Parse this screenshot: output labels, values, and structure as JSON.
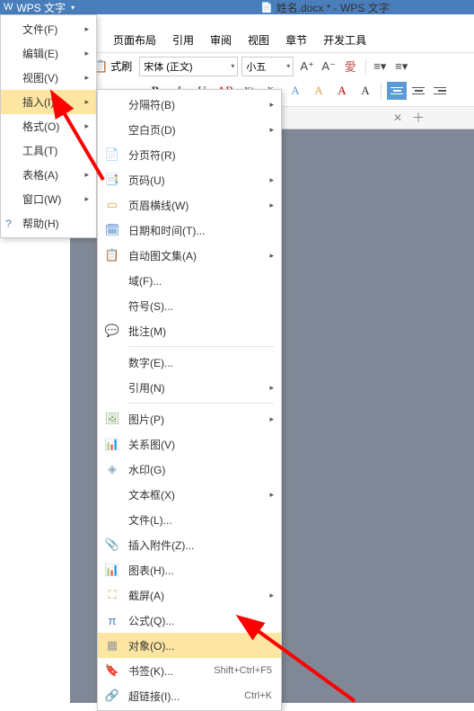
{
  "titlebar": {
    "app_name": "WPS 文字"
  },
  "doc": {
    "title": "姓名.docx * - WPS 文字"
  },
  "menubar": {
    "items": [
      "页面布局",
      "引用",
      "审阅",
      "视图",
      "章节",
      "开发工具"
    ]
  },
  "toolbar": {
    "format_brush": "式刷",
    "font": "宋体 (正文)",
    "size": "小五"
  },
  "format_buttons": {
    "bold": "B",
    "italic": "I",
    "underline": "U",
    "strike": "AB",
    "super": "X²",
    "sub": "X₂",
    "a1": "A",
    "a2": "A",
    "a3": "A",
    "a4": "A"
  },
  "classic_menu": {
    "items": [
      {
        "label": "文件(F)",
        "arrow": true
      },
      {
        "label": "编辑(E)",
        "arrow": true
      },
      {
        "label": "视图(V)",
        "arrow": true
      },
      {
        "label": "插入(I)",
        "arrow": true,
        "highlight": true
      },
      {
        "label": "格式(O)",
        "arrow": true
      },
      {
        "label": "工具(T)",
        "arrow": true
      },
      {
        "label": "表格(A)",
        "arrow": true
      },
      {
        "label": "窗口(W)",
        "arrow": true
      },
      {
        "label": "帮助(H)",
        "arrow": false,
        "icon": "?"
      }
    ]
  },
  "insert_menu": {
    "items": [
      {
        "label": "分隔符(B)",
        "icon": "",
        "arrow": true
      },
      {
        "label": "空白页(D)",
        "icon": "",
        "arrow": true
      },
      {
        "label": "分页符(R)",
        "icon": "📄",
        "color": "#d9a54a"
      },
      {
        "label": "页码(U)",
        "icon": "📑",
        "color": "#d9a54a",
        "arrow": true
      },
      {
        "label": "页眉横线(W)",
        "icon": "▭",
        "color": "#d9a54a",
        "arrow": true
      },
      {
        "label": "日期和时间(T)...",
        "icon": "🗓",
        "color": "#3a7bc8"
      },
      {
        "label": "自动图文集(A)",
        "icon": "📋",
        "color": "#7a9e5e",
        "arrow": true
      },
      {
        "label": "域(F)...",
        "icon": ""
      },
      {
        "label": "符号(S)...",
        "icon": ""
      },
      {
        "label": "批注(M)",
        "icon": "💬",
        "color": "#d9a54a"
      },
      {
        "sep": true
      },
      {
        "label": "数字(E)...",
        "icon": ""
      },
      {
        "label": "引用(N)",
        "icon": "",
        "arrow": true
      },
      {
        "sep": true
      },
      {
        "label": "图片(P)",
        "icon": "🖼",
        "color": "#7a9e5e",
        "arrow": true
      },
      {
        "label": "关系图(V)",
        "icon": "📊",
        "color": "#3a7bc8"
      },
      {
        "label": "水印(G)",
        "icon": "◈",
        "color": "#8aa8c8"
      },
      {
        "label": "文本框(X)",
        "icon": "",
        "arrow": true
      },
      {
        "label": "文件(L)...",
        "icon": ""
      },
      {
        "label": "插入附件(Z)...",
        "icon": "📎",
        "color": "#d9a54a"
      },
      {
        "label": "图表(H)...",
        "icon": "📊",
        "color": "#7a9e5e"
      },
      {
        "label": "截屏(A)",
        "icon": "⛶",
        "color": "#d9a54a",
        "arrow": true
      },
      {
        "label": "公式(Q)...",
        "icon": "π",
        "color": "#3a7bc8"
      },
      {
        "label": "对象(O)...",
        "icon": "▦",
        "color": "#999",
        "highlight": true
      },
      {
        "label": "书签(K)...",
        "icon": "🔖",
        "color": "#d9a54a",
        "shortcut": "Shift+Ctrl+F5"
      },
      {
        "label": "超链接(I)...",
        "icon": "🔗",
        "color": "#3a7bc8",
        "shortcut": "Ctrl+K"
      }
    ]
  }
}
